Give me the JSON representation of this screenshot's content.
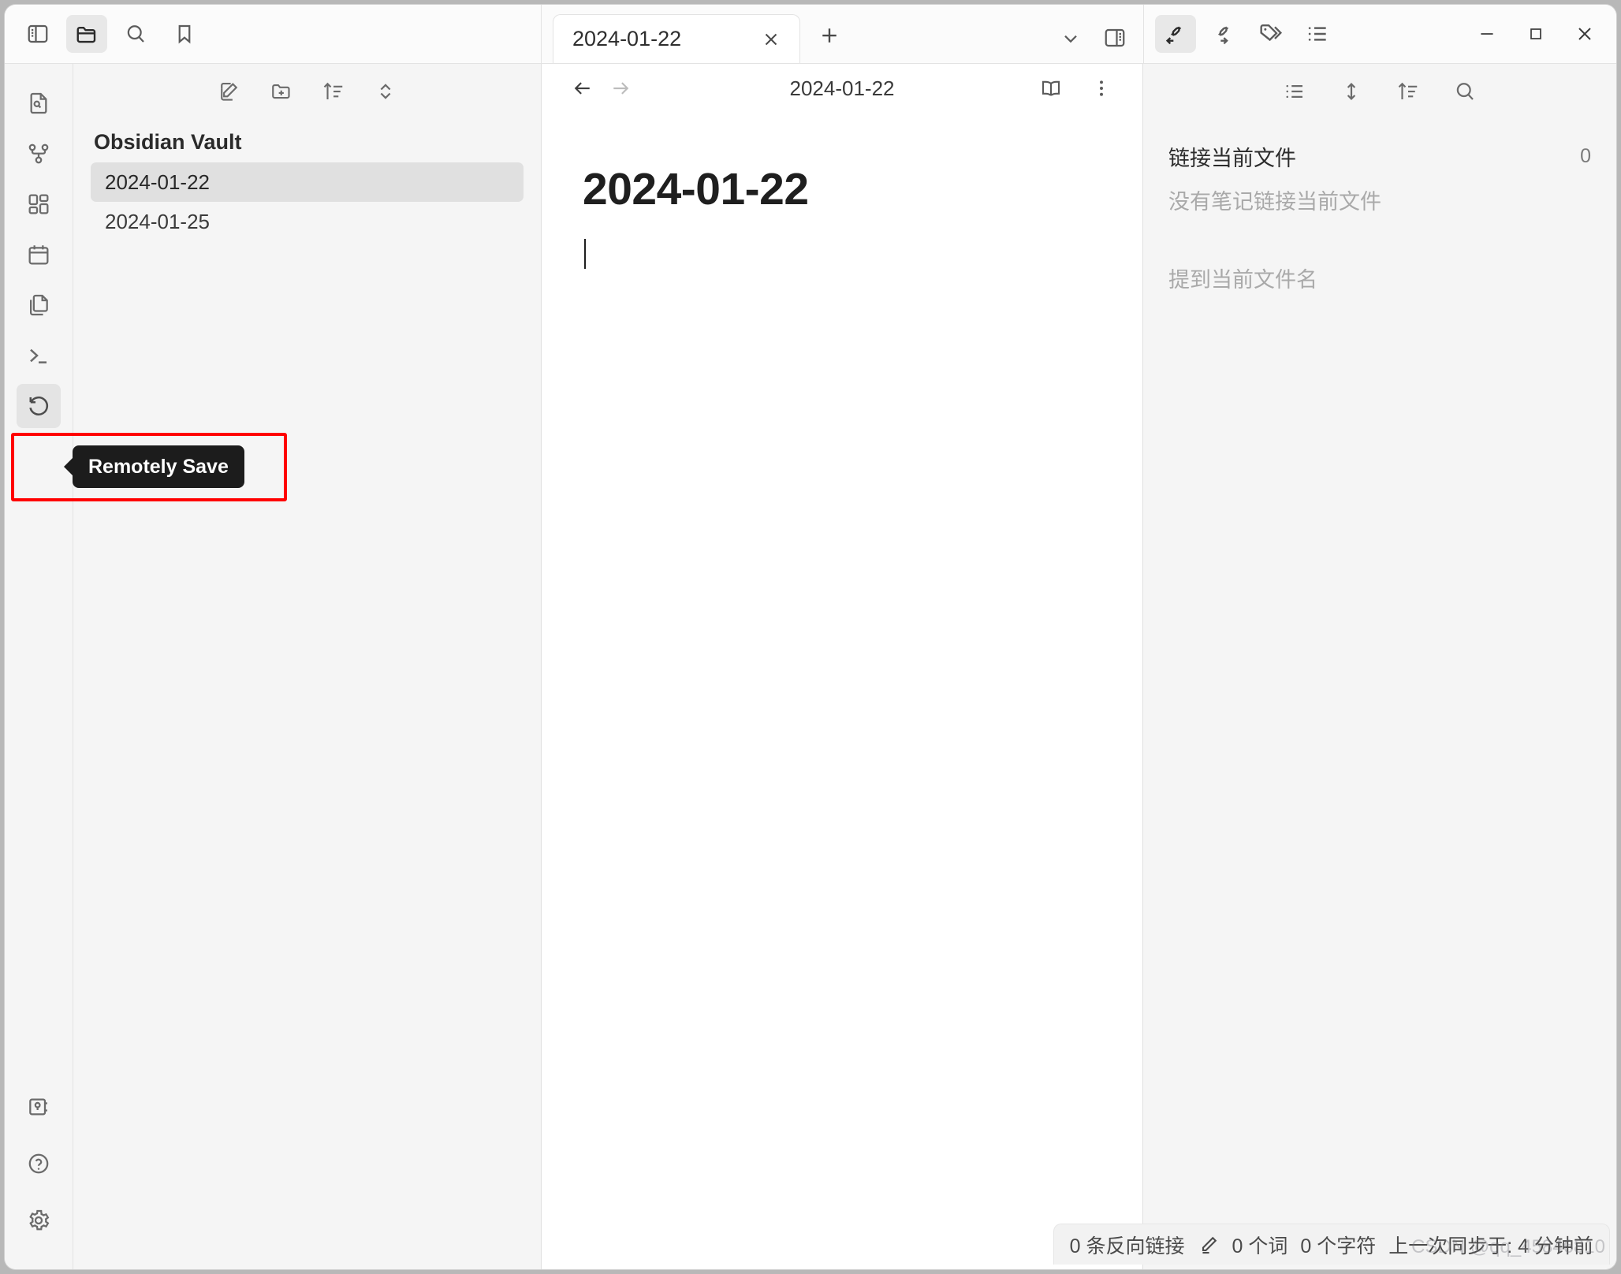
{
  "titlebar": {
    "left_icons": [
      {
        "name": "toggle-left-sidebar-icon",
        "label": "Toggle left sidebar",
        "active": false
      },
      {
        "name": "folder-icon",
        "label": "Files",
        "active": true
      },
      {
        "name": "search-icon",
        "label": "Search",
        "active": false
      },
      {
        "name": "bookmark-icon",
        "label": "Bookmarks",
        "active": false
      }
    ],
    "tab": {
      "title": "2024-01-22",
      "close_label": "×"
    },
    "new_tab_label": "+",
    "tab_list_label": "⌄",
    "right_icons": [
      {
        "name": "backlinks-icon",
        "label": "Backlinks",
        "active": true
      },
      {
        "name": "outgoing-links-icon",
        "label": "Outgoing links",
        "active": false
      },
      {
        "name": "tags-icon",
        "label": "Tags",
        "active": false
      },
      {
        "name": "outline-icon",
        "label": "Outline",
        "active": false
      }
    ],
    "window_controls": [
      {
        "name": "minimize-button",
        "label": "–"
      },
      {
        "name": "maximize-button",
        "label": "□"
      },
      {
        "name": "close-button",
        "label": "✕"
      }
    ]
  },
  "ribbon": {
    "items": [
      {
        "name": "ribbon-quick-switcher-icon",
        "label": "Quick switcher"
      },
      {
        "name": "ribbon-graph-view-icon",
        "label": "Graph view"
      },
      {
        "name": "ribbon-canvas-icon",
        "label": "Canvas"
      },
      {
        "name": "ribbon-calendar-icon",
        "label": "Calendar"
      },
      {
        "name": "ribbon-daily-note-icon",
        "label": "Daily note"
      },
      {
        "name": "ribbon-terminal-icon",
        "label": "Terminal"
      },
      {
        "name": "ribbon-remotely-save-icon",
        "label": "Remotely Save"
      }
    ],
    "bottom_items": [
      {
        "name": "ribbon-vault-switcher-icon",
        "label": "Open another vault"
      },
      {
        "name": "ribbon-help-icon",
        "label": "Help"
      },
      {
        "name": "ribbon-settings-icon",
        "label": "Settings"
      }
    ],
    "tooltip": {
      "text": "Remotely Save"
    },
    "annotation": {
      "color": "#ff0000"
    }
  },
  "explorer": {
    "toolbar": [
      {
        "name": "new-note-icon",
        "label": "New note"
      },
      {
        "name": "new-folder-icon",
        "label": "New folder"
      },
      {
        "name": "sort-order-icon",
        "label": "Change sort order"
      },
      {
        "name": "collapse-expand-icon",
        "label": "Expand / collapse all"
      }
    ],
    "vault_name": "Obsidian Vault",
    "files": [
      {
        "name": "2024-01-22",
        "selected": true
      },
      {
        "name": "2024-01-25",
        "selected": false
      }
    ]
  },
  "editor": {
    "back_label": "←",
    "forward_label": "→",
    "title": "2024-01-22",
    "reading_mode_icon_label": "Reading view",
    "more_options_label": "More options",
    "document": {
      "heading": "2024-01-22",
      "body": ""
    }
  },
  "right_panel": {
    "toolbar": [
      {
        "name": "collapse-results-icon",
        "label": "Collapse results"
      },
      {
        "name": "show-more-context-icon",
        "label": "Show more context"
      },
      {
        "name": "change-sort-order-icon",
        "label": "Change sort order"
      },
      {
        "name": "search-backlinks-icon",
        "label": "Search backlinks"
      }
    ],
    "linked_mentions_title": "链接当前文件",
    "linked_mentions_count": "0",
    "linked_mentions_empty": "没有笔记链接当前文件",
    "unlinked_mentions_title": "提到当前文件名"
  },
  "statusbar": {
    "backlinks": "0 条反向链接",
    "edit_icon_label": "编辑模式",
    "words": "0 个词",
    "chars": "0 个字符",
    "sync": "上一次同步于: 4 分钟前"
  },
  "watermark": {
    "text": "CSDN @qq_45846810"
  },
  "colors": {
    "accent_red": "#ff0000",
    "tooltip_bg": "#1c1c1c",
    "panel_bg": "#f5f5f5",
    "editor_bg": "#ffffff",
    "selected_item_bg": "#e0e0e0"
  }
}
